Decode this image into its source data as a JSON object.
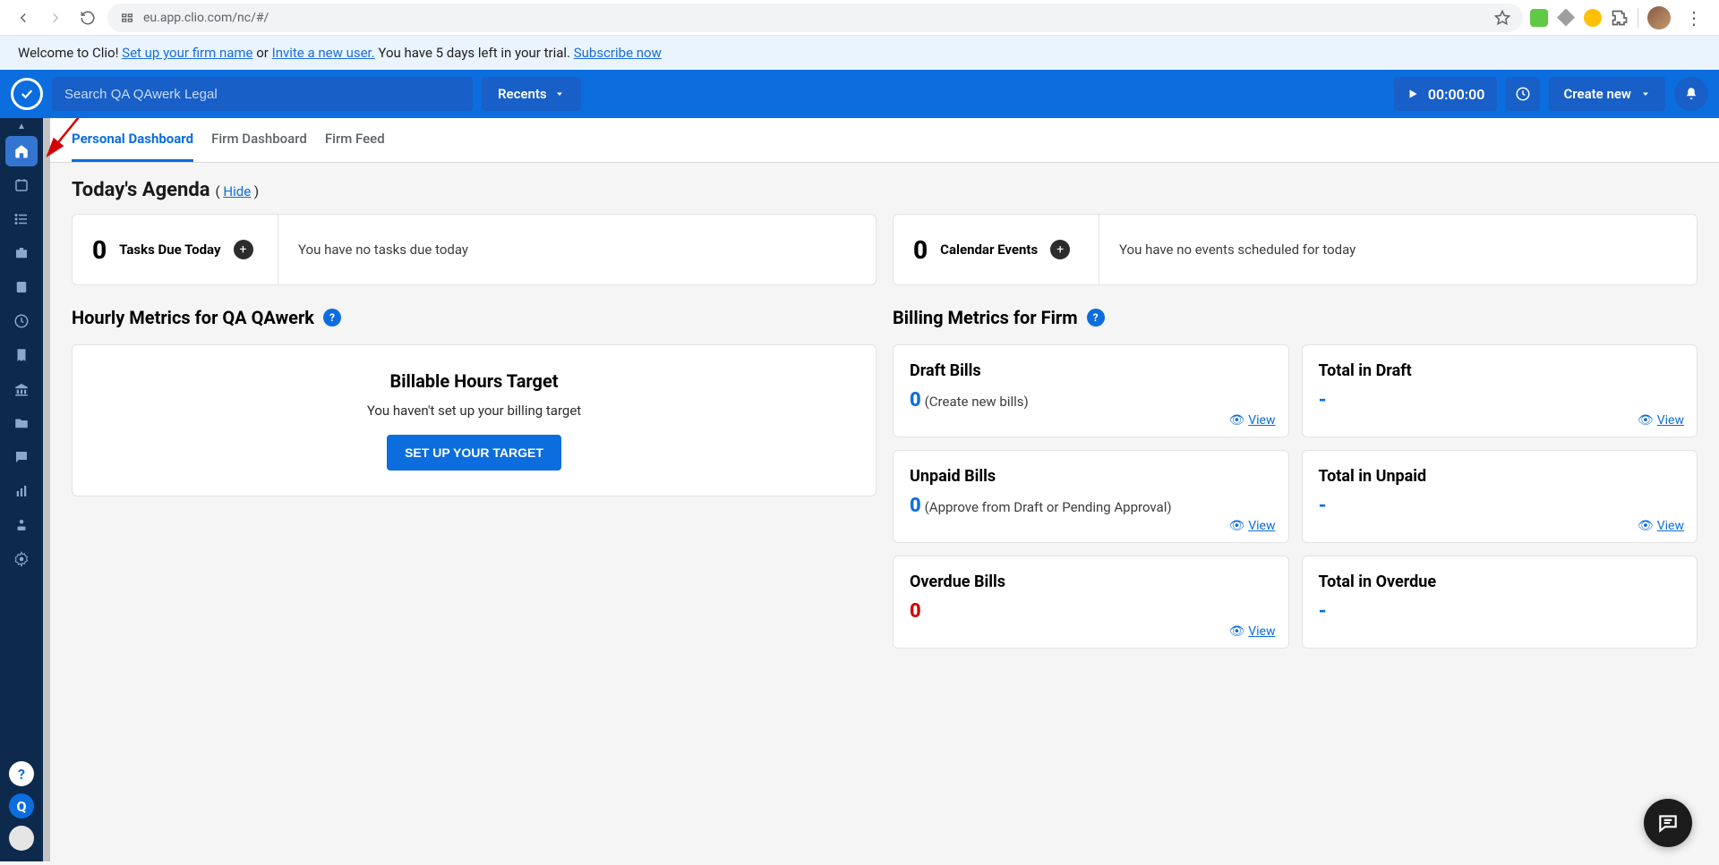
{
  "browser": {
    "url": "eu.app.clio.com/nc/#/"
  },
  "banner": {
    "welcome": "Welcome to Clio!",
    "setup_link": "Set up your firm name",
    "or": " or ",
    "invite_link": "Invite a new user.",
    "trial_text": "  You have 5 days left in your trial. ",
    "subscribe_link": "Subscribe now"
  },
  "header": {
    "search_placeholder": "Search QA QAwerk Legal",
    "recents": "Recents",
    "timer": "00:00:00",
    "create": "Create new"
  },
  "tabs": {
    "personal": "Personal Dashboard",
    "firm": "Firm Dashboard",
    "feed": "Firm Feed"
  },
  "agenda": {
    "title": "Today's Agenda",
    "hide": "Hide",
    "tasks": {
      "count": "0",
      "label": "Tasks Due Today",
      "empty": "You have no tasks due today"
    },
    "events": {
      "count": "0",
      "label": "Calendar Events",
      "empty": "You have no events scheduled for today"
    }
  },
  "hourly": {
    "title": "Hourly Metrics for QA QAwerk",
    "card_title": "Billable Hours Target",
    "card_sub": "You haven't set up your billing target",
    "button": "SET UP YOUR TARGET"
  },
  "billing": {
    "title": "Billing Metrics for Firm",
    "view": "View",
    "draft_bills": {
      "title": "Draft Bills",
      "value": "0",
      "paren_open": " (",
      "link": "Create new bills",
      "paren_close": ")"
    },
    "total_draft": {
      "title": "Total in Draft",
      "value": "-"
    },
    "unpaid_bills": {
      "title": "Unpaid Bills",
      "value": "0",
      "approve_pre": " (Approve from ",
      "draft_link": "Draft",
      "or": " or ",
      "pending_link": "Pending Approval",
      "close": ")"
    },
    "total_unpaid": {
      "title": "Total in Unpaid",
      "value": "-"
    },
    "overdue_bills": {
      "title": "Overdue Bills",
      "value": "0"
    },
    "total_overdue": {
      "title": "Total in Overdue",
      "value": "-"
    }
  },
  "sidebar": {
    "help": "?",
    "q": "Q"
  }
}
